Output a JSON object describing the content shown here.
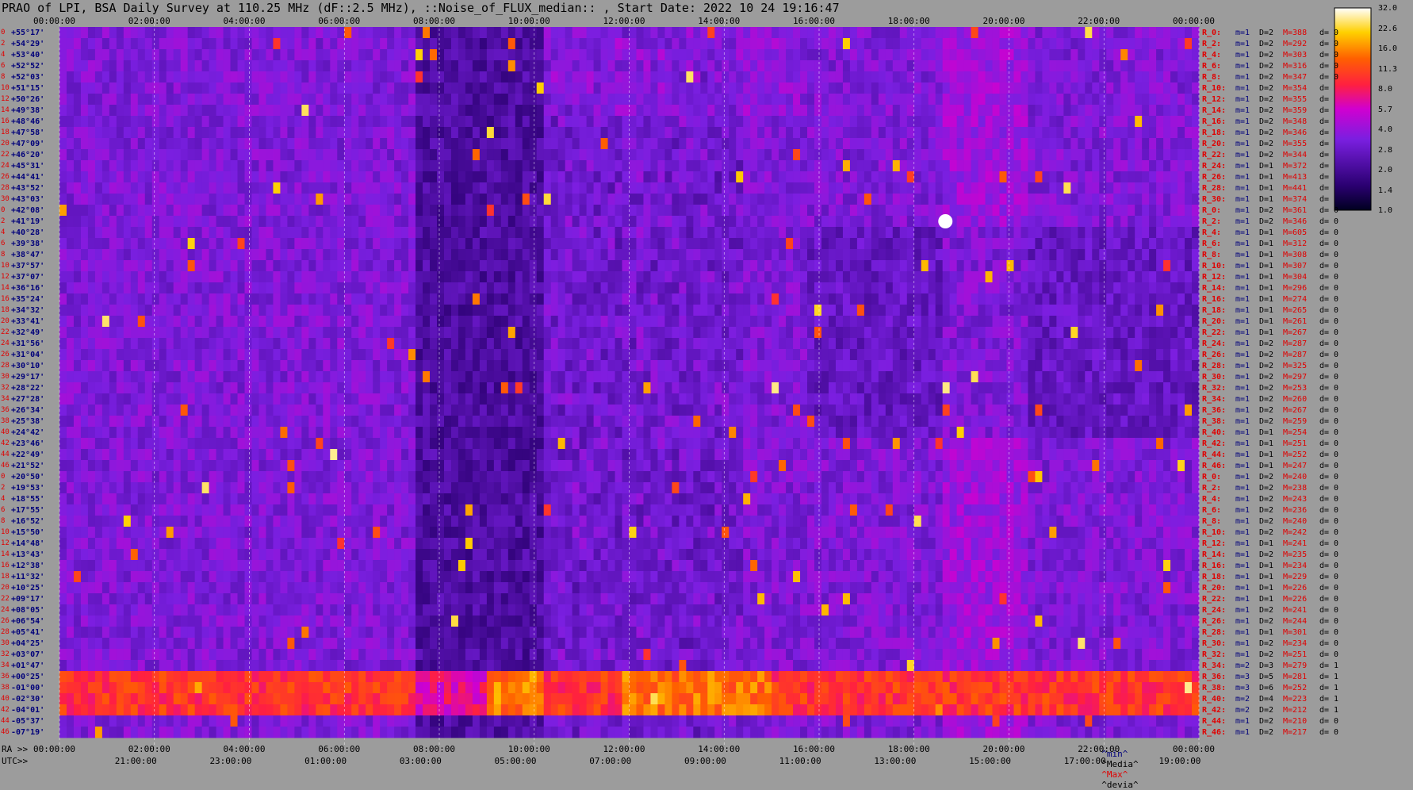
{
  "title": "PRAO of LPI, BSA Daily Survey at 110.25 MHz (dF::2.5 MHz), ::Noise_of_FLUX_median:: , Start Date: 2022 10 24 19:16:47",
  "chart_data": {
    "type": "heatmap",
    "title": "PRAO of LPI, BSA Daily Survey at 110.25 MHz (dF::2.5 MHz), ::Noise_of_FLUX_median:: , Start Date: 2022 10 24 19:16:47",
    "x_top_ticks": [
      "00:00:00",
      "02:00:00",
      "04:00:00",
      "06:00:00",
      "08:00:00",
      "10:00:00",
      "12:00:00",
      "14:00:00",
      "16:00:00",
      "18:00:00",
      "20:00:00",
      "22:00:00",
      "00:00:00"
    ],
    "x_bottom_ra_label": "RA >>",
    "x_bottom_ra_ticks": [
      "00:00:00",
      "02:00:00",
      "04:00:00",
      "06:00:00",
      "08:00:00",
      "10:00:00",
      "12:00:00",
      "14:00:00",
      "16:00:00",
      "18:00:00",
      "20:00:00",
      "22:00:00",
      "00:00:00"
    ],
    "x_bottom_utc_label": "UTC>>",
    "x_bottom_utc_ticks": [
      "21:00:00",
      "23:00:00",
      "01:00:00",
      "03:00:00",
      "05:00:00",
      "07:00:00",
      "09:00:00",
      "11:00:00",
      "13:00:00",
      "15:00:00",
      "17:00:00",
      "19:00:00"
    ],
    "colorbar": {
      "min": 1.0,
      "max": 32.0,
      "ticks": [
        "32.0",
        "22.6",
        "16.0",
        "11.3",
        "8.0",
        "5.7",
        "4.0",
        "2.8",
        "2.0",
        "1.4",
        "1.0"
      ]
    },
    "rows": [
      {
        "idx": "0",
        "dec": "+55°17'",
        "r": "R_0:",
        "m": "1",
        "D": "2",
        "M": "388",
        "d": "0"
      },
      {
        "idx": "2",
        "dec": "+54°29'",
        "r": "R_2:",
        "m": "1",
        "D": "2",
        "M": "292",
        "d": "0"
      },
      {
        "idx": "4",
        "dec": "+53°40'",
        "r": "R_4:",
        "m": "1",
        "D": "2",
        "M": "303",
        "d": "0"
      },
      {
        "idx": "6",
        "dec": "+52°52'",
        "r": "R_6:",
        "m": "1",
        "D": "2",
        "M": "316",
        "d": "0"
      },
      {
        "idx": "8",
        "dec": "+52°03'",
        "r": "R_8:",
        "m": "1",
        "D": "2",
        "M": "347",
        "d": "0"
      },
      {
        "idx": "10",
        "dec": "+51°15'",
        "r": "R_10:",
        "m": "1",
        "D": "2",
        "M": "354",
        "d": ""
      },
      {
        "idx": "12",
        "dec": "+50°26'",
        "r": "R_12:",
        "m": "1",
        "D": "2",
        "M": "355",
        "d": ""
      },
      {
        "idx": "14",
        "dec": "+49°38'",
        "r": "R_14:",
        "m": "1",
        "D": "2",
        "M": "359",
        "d": ""
      },
      {
        "idx": "16",
        "dec": "+48°46'",
        "r": "R_16:",
        "m": "1",
        "D": "2",
        "M": "348",
        "d": ""
      },
      {
        "idx": "18",
        "dec": "+47°58'",
        "r": "R_18:",
        "m": "1",
        "D": "2",
        "M": "346",
        "d": ""
      },
      {
        "idx": "20",
        "dec": "+47°09'",
        "r": "R_20:",
        "m": "1",
        "D": "2",
        "M": "355",
        "d": ""
      },
      {
        "idx": "22",
        "dec": "+46°20'",
        "r": "R_22:",
        "m": "1",
        "D": "2",
        "M": "344",
        "d": ""
      },
      {
        "idx": "24",
        "dec": "+45°31'",
        "r": "R_24:",
        "m": "1",
        "D": "1",
        "M": "372",
        "d": ""
      },
      {
        "idx": "26",
        "dec": "+44°41'",
        "r": "R_26:",
        "m": "1",
        "D": "1",
        "M": "413",
        "d": ""
      },
      {
        "idx": "28",
        "dec": "+43°52'",
        "r": "R_28:",
        "m": "1",
        "D": "1",
        "M": "441",
        "d": ""
      },
      {
        "idx": "30",
        "dec": "+43°03'",
        "r": "R_30:",
        "m": "1",
        "D": "1",
        "M": "374",
        "d": ""
      },
      {
        "idx": "0",
        "dec": "+42°08'",
        "r": "R_0:",
        "m": "1",
        "D": "2",
        "M": "361",
        "d": "0"
      },
      {
        "idx": "2",
        "dec": "+41°19'",
        "r": "R_2:",
        "m": "1",
        "D": "2",
        "M": "346",
        "d": "0"
      },
      {
        "idx": "4",
        "dec": "+40°28'",
        "r": "R_4:",
        "m": "1",
        "D": "1",
        "M": "605",
        "d": "0"
      },
      {
        "idx": "6",
        "dec": "+39°38'",
        "r": "R_6:",
        "m": "1",
        "D": "1",
        "M": "312",
        "d": "0"
      },
      {
        "idx": "8",
        "dec": "+38°47'",
        "r": "R_8:",
        "m": "1",
        "D": "1",
        "M": "308",
        "d": "0"
      },
      {
        "idx": "10",
        "dec": "+37°57'",
        "r": "R_10:",
        "m": "1",
        "D": "1",
        "M": "307",
        "d": "0"
      },
      {
        "idx": "12",
        "dec": "+37°07'",
        "r": "R_12:",
        "m": "1",
        "D": "1",
        "M": "304",
        "d": "0"
      },
      {
        "idx": "14",
        "dec": "+36°16'",
        "r": "R_14:",
        "m": "1",
        "D": "1",
        "M": "296",
        "d": "0"
      },
      {
        "idx": "16",
        "dec": "+35°24'",
        "r": "R_16:",
        "m": "1",
        "D": "1",
        "M": "274",
        "d": "0"
      },
      {
        "idx": "18",
        "dec": "+34°32'",
        "r": "R_18:",
        "m": "1",
        "D": "1",
        "M": "265",
        "d": "0"
      },
      {
        "idx": "20",
        "dec": "+33°41'",
        "r": "R_20:",
        "m": "1",
        "D": "1",
        "M": "261",
        "d": "0"
      },
      {
        "idx": "22",
        "dec": "+32°49'",
        "r": "R_22:",
        "m": "1",
        "D": "1",
        "M": "267",
        "d": "0"
      },
      {
        "idx": "24",
        "dec": "+31°56'",
        "r": "R_24:",
        "m": "1",
        "D": "2",
        "M": "287",
        "d": "0"
      },
      {
        "idx": "26",
        "dec": "+31°04'",
        "r": "R_26:",
        "m": "1",
        "D": "2",
        "M": "287",
        "d": "0"
      },
      {
        "idx": "28",
        "dec": "+30°10'",
        "r": "R_28:",
        "m": "1",
        "D": "2",
        "M": "325",
        "d": "0"
      },
      {
        "idx": "30",
        "dec": "+29°17'",
        "r": "R_30:",
        "m": "1",
        "D": "2",
        "M": "297",
        "d": "0"
      },
      {
        "idx": "32",
        "dec": "+28°22'",
        "r": "R_32:",
        "m": "1",
        "D": "2",
        "M": "253",
        "d": "0"
      },
      {
        "idx": "34",
        "dec": "+27°28'",
        "r": "R_34:",
        "m": "1",
        "D": "2",
        "M": "260",
        "d": "0"
      },
      {
        "idx": "36",
        "dec": "+26°34'",
        "r": "R_36:",
        "m": "1",
        "D": "2",
        "M": "267",
        "d": "0"
      },
      {
        "idx": "38",
        "dec": "+25°38'",
        "r": "R_38:",
        "m": "1",
        "D": "2",
        "M": "259",
        "d": "0"
      },
      {
        "idx": "40",
        "dec": "+24°42'",
        "r": "R_40:",
        "m": "1",
        "D": "1",
        "M": "254",
        "d": "0"
      },
      {
        "idx": "42",
        "dec": "+23°46'",
        "r": "R_42:",
        "m": "1",
        "D": "1",
        "M": "251",
        "d": "0"
      },
      {
        "idx": "44",
        "dec": "+22°49'",
        "r": "R_44:",
        "m": "1",
        "D": "1",
        "M": "252",
        "d": "0"
      },
      {
        "idx": "46",
        "dec": "+21°52'",
        "r": "R_46:",
        "m": "1",
        "D": "1",
        "M": "247",
        "d": "0"
      },
      {
        "idx": "0",
        "dec": "+20°50'",
        "r": "R_0:",
        "m": "1",
        "D": "2",
        "M": "240",
        "d": "0"
      },
      {
        "idx": "2",
        "dec": "+19°53'",
        "r": "R_2:",
        "m": "1",
        "D": "2",
        "M": "238",
        "d": "0"
      },
      {
        "idx": "4",
        "dec": "+18°55'",
        "r": "R_4:",
        "m": "1",
        "D": "2",
        "M": "243",
        "d": "0"
      },
      {
        "idx": "6",
        "dec": "+17°55'",
        "r": "R_6:",
        "m": "1",
        "D": "2",
        "M": "236",
        "d": "0"
      },
      {
        "idx": "8",
        "dec": "+16°52'",
        "r": "R_8:",
        "m": "1",
        "D": "2",
        "M": "240",
        "d": "0"
      },
      {
        "idx": "10",
        "dec": "+15°50'",
        "r": "R_10:",
        "m": "1",
        "D": "2",
        "M": "242",
        "d": "0"
      },
      {
        "idx": "12",
        "dec": "+14°48'",
        "r": "R_12:",
        "m": "1",
        "D": "1",
        "M": "241",
        "d": "0"
      },
      {
        "idx": "14",
        "dec": "+13°43'",
        "r": "R_14:",
        "m": "1",
        "D": "2",
        "M": "235",
        "d": "0"
      },
      {
        "idx": "16",
        "dec": "+12°38'",
        "r": "R_16:",
        "m": "1",
        "D": "1",
        "M": "234",
        "d": "0"
      },
      {
        "idx": "18",
        "dec": "+11°32'",
        "r": "R_18:",
        "m": "1",
        "D": "1",
        "M": "229",
        "d": "0"
      },
      {
        "idx": "20",
        "dec": "+10°25'",
        "r": "R_20:",
        "m": "1",
        "D": "1",
        "M": "226",
        "d": "0"
      },
      {
        "idx": "22",
        "dec": "+09°17'",
        "r": "R_22:",
        "m": "1",
        "D": "1",
        "M": "226",
        "d": "0"
      },
      {
        "idx": "24",
        "dec": "+08°05'",
        "r": "R_24:",
        "m": "1",
        "D": "2",
        "M": "241",
        "d": "0"
      },
      {
        "idx": "26",
        "dec": "+06°54'",
        "r": "R_26:",
        "m": "1",
        "D": "2",
        "M": "244",
        "d": "0"
      },
      {
        "idx": "28",
        "dec": "+05°41'",
        "r": "R_28:",
        "m": "1",
        "D": "1",
        "M": "301",
        "d": "0"
      },
      {
        "idx": "30",
        "dec": "+04°25'",
        "r": "R_30:",
        "m": "1",
        "D": "2",
        "M": "234",
        "d": "0"
      },
      {
        "idx": "32",
        "dec": "+03°07'",
        "r": "R_32:",
        "m": "1",
        "D": "2",
        "M": "251",
        "d": "0"
      },
      {
        "idx": "34",
        "dec": "+01°47'",
        "r": "R_34:",
        "m": "2",
        "D": "3",
        "M": "279",
        "d": "1"
      },
      {
        "idx": "36",
        "dec": "+00°25'",
        "r": "R_36:",
        "m": "3",
        "D": "5",
        "M": "281",
        "d": "1"
      },
      {
        "idx": "38",
        "dec": "-01°00'",
        "r": "R_38:",
        "m": "3",
        "D": "6",
        "M": "252",
        "d": "1"
      },
      {
        "idx": "40",
        "dec": "-02°30'",
        "r": "R_40:",
        "m": "2",
        "D": "4",
        "M": "223",
        "d": "1"
      },
      {
        "idx": "42",
        "dec": "-04°01'",
        "r": "R_42:",
        "m": "2",
        "D": "2",
        "M": "212",
        "d": "1"
      },
      {
        "idx": "44",
        "dec": "-05°37'",
        "r": "R_44:",
        "m": "1",
        "D": "2",
        "M": "210",
        "d": "0"
      },
      {
        "idx": "46",
        "dec": "-07°19'",
        "r": "R_46:",
        "m": "1",
        "D": "2",
        "M": "217",
        "d": "0"
      }
    ],
    "footer": [
      "^min^",
      "^Media^",
      "^Max^",
      "^devia^"
    ],
    "colors": {
      "label_red": "#e00000",
      "label_navy": "#00007a",
      "background": "#9c9c9c"
    },
    "grid": true,
    "legend": "right"
  }
}
